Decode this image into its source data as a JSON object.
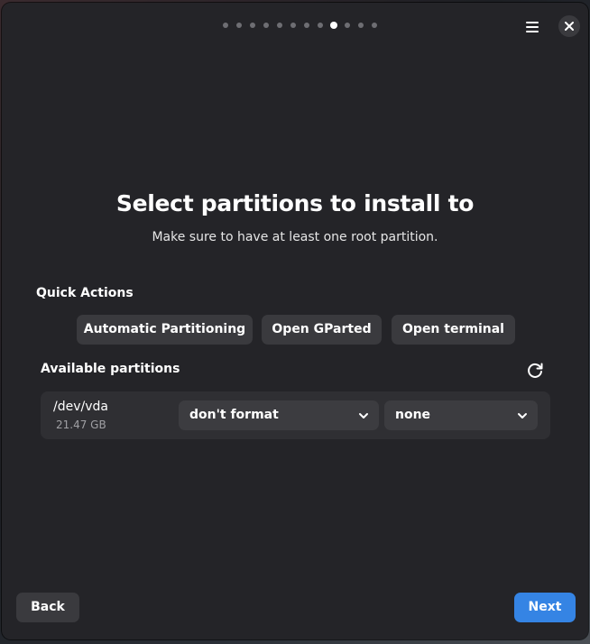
{
  "header": {
    "page_count": 12,
    "current_page": 9,
    "menu_icon": "hamburger-menu-icon",
    "close_icon": "close-icon"
  },
  "main": {
    "title": "Select partitions to install to",
    "subtitle": "Make sure to have at least one root partition."
  },
  "quick_actions": {
    "label": "Quick Actions",
    "buttons": [
      {
        "label": "Automatic Partitioning"
      },
      {
        "label": "Open GParted"
      },
      {
        "label": "Open terminal"
      }
    ]
  },
  "partitions": {
    "label": "Available partitions",
    "refresh_icon": "refresh-icon",
    "rows": [
      {
        "device": "/dev/vda",
        "size": "21.47 GB",
        "format_value": "don't format",
        "mount_value": "none"
      }
    ]
  },
  "footer": {
    "back_label": "Back",
    "next_label": "Next"
  },
  "colors": {
    "accent": "#3584e4",
    "window_bg": "#242428",
    "button_bg": "#3a3a3e"
  }
}
